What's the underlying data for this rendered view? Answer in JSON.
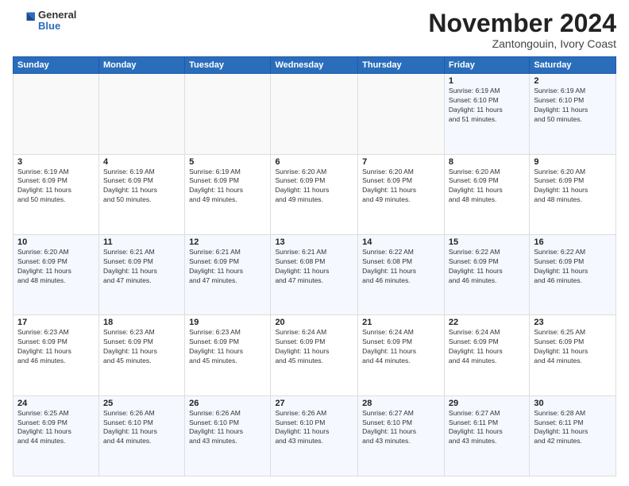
{
  "logo": {
    "general": "General",
    "blue": "Blue"
  },
  "title": "November 2024",
  "location": "Zantongouin, Ivory Coast",
  "days_header": [
    "Sunday",
    "Monday",
    "Tuesday",
    "Wednesday",
    "Thursday",
    "Friday",
    "Saturday"
  ],
  "weeks": [
    [
      {
        "day": "",
        "info": ""
      },
      {
        "day": "",
        "info": ""
      },
      {
        "day": "",
        "info": ""
      },
      {
        "day": "",
        "info": ""
      },
      {
        "day": "",
        "info": ""
      },
      {
        "day": "1",
        "info": "Sunrise: 6:19 AM\nSunset: 6:10 PM\nDaylight: 11 hours\nand 51 minutes."
      },
      {
        "day": "2",
        "info": "Sunrise: 6:19 AM\nSunset: 6:10 PM\nDaylight: 11 hours\nand 50 minutes."
      }
    ],
    [
      {
        "day": "3",
        "info": "Sunrise: 6:19 AM\nSunset: 6:09 PM\nDaylight: 11 hours\nand 50 minutes."
      },
      {
        "day": "4",
        "info": "Sunrise: 6:19 AM\nSunset: 6:09 PM\nDaylight: 11 hours\nand 50 minutes."
      },
      {
        "day": "5",
        "info": "Sunrise: 6:19 AM\nSunset: 6:09 PM\nDaylight: 11 hours\nand 49 minutes."
      },
      {
        "day": "6",
        "info": "Sunrise: 6:20 AM\nSunset: 6:09 PM\nDaylight: 11 hours\nand 49 minutes."
      },
      {
        "day": "7",
        "info": "Sunrise: 6:20 AM\nSunset: 6:09 PM\nDaylight: 11 hours\nand 49 minutes."
      },
      {
        "day": "8",
        "info": "Sunrise: 6:20 AM\nSunset: 6:09 PM\nDaylight: 11 hours\nand 48 minutes."
      },
      {
        "day": "9",
        "info": "Sunrise: 6:20 AM\nSunset: 6:09 PM\nDaylight: 11 hours\nand 48 minutes."
      }
    ],
    [
      {
        "day": "10",
        "info": "Sunrise: 6:20 AM\nSunset: 6:09 PM\nDaylight: 11 hours\nand 48 minutes."
      },
      {
        "day": "11",
        "info": "Sunrise: 6:21 AM\nSunset: 6:09 PM\nDaylight: 11 hours\nand 47 minutes."
      },
      {
        "day": "12",
        "info": "Sunrise: 6:21 AM\nSunset: 6:09 PM\nDaylight: 11 hours\nand 47 minutes."
      },
      {
        "day": "13",
        "info": "Sunrise: 6:21 AM\nSunset: 6:08 PM\nDaylight: 11 hours\nand 47 minutes."
      },
      {
        "day": "14",
        "info": "Sunrise: 6:22 AM\nSunset: 6:08 PM\nDaylight: 11 hours\nand 46 minutes."
      },
      {
        "day": "15",
        "info": "Sunrise: 6:22 AM\nSunset: 6:09 PM\nDaylight: 11 hours\nand 46 minutes."
      },
      {
        "day": "16",
        "info": "Sunrise: 6:22 AM\nSunset: 6:09 PM\nDaylight: 11 hours\nand 46 minutes."
      }
    ],
    [
      {
        "day": "17",
        "info": "Sunrise: 6:23 AM\nSunset: 6:09 PM\nDaylight: 11 hours\nand 46 minutes."
      },
      {
        "day": "18",
        "info": "Sunrise: 6:23 AM\nSunset: 6:09 PM\nDaylight: 11 hours\nand 45 minutes."
      },
      {
        "day": "19",
        "info": "Sunrise: 6:23 AM\nSunset: 6:09 PM\nDaylight: 11 hours\nand 45 minutes."
      },
      {
        "day": "20",
        "info": "Sunrise: 6:24 AM\nSunset: 6:09 PM\nDaylight: 11 hours\nand 45 minutes."
      },
      {
        "day": "21",
        "info": "Sunrise: 6:24 AM\nSunset: 6:09 PM\nDaylight: 11 hours\nand 44 minutes."
      },
      {
        "day": "22",
        "info": "Sunrise: 6:24 AM\nSunset: 6:09 PM\nDaylight: 11 hours\nand 44 minutes."
      },
      {
        "day": "23",
        "info": "Sunrise: 6:25 AM\nSunset: 6:09 PM\nDaylight: 11 hours\nand 44 minutes."
      }
    ],
    [
      {
        "day": "24",
        "info": "Sunrise: 6:25 AM\nSunset: 6:09 PM\nDaylight: 11 hours\nand 44 minutes."
      },
      {
        "day": "25",
        "info": "Sunrise: 6:26 AM\nSunset: 6:10 PM\nDaylight: 11 hours\nand 44 minutes."
      },
      {
        "day": "26",
        "info": "Sunrise: 6:26 AM\nSunset: 6:10 PM\nDaylight: 11 hours\nand 43 minutes."
      },
      {
        "day": "27",
        "info": "Sunrise: 6:26 AM\nSunset: 6:10 PM\nDaylight: 11 hours\nand 43 minutes."
      },
      {
        "day": "28",
        "info": "Sunrise: 6:27 AM\nSunset: 6:10 PM\nDaylight: 11 hours\nand 43 minutes."
      },
      {
        "day": "29",
        "info": "Sunrise: 6:27 AM\nSunset: 6:11 PM\nDaylight: 11 hours\nand 43 minutes."
      },
      {
        "day": "30",
        "info": "Sunrise: 6:28 AM\nSunset: 6:11 PM\nDaylight: 11 hours\nand 42 minutes."
      }
    ]
  ]
}
